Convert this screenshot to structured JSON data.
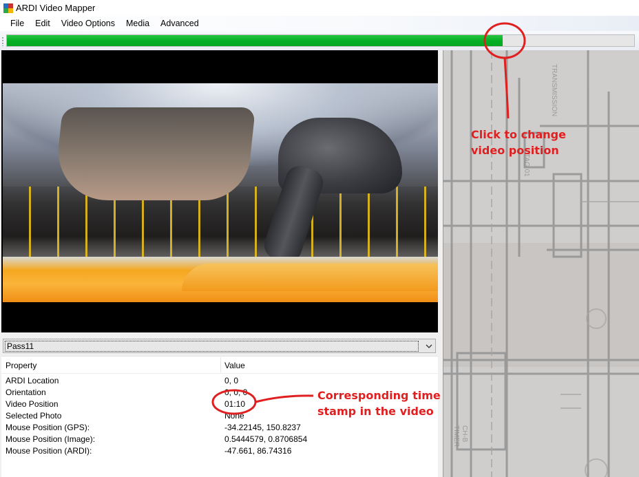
{
  "window": {
    "title": "ARDI Video Mapper"
  },
  "menu": {
    "items": [
      "File",
      "Edit",
      "Video Options",
      "Media",
      "Advanced"
    ]
  },
  "seekbar": {
    "progress": 0.79,
    "fill_color": "#06b025"
  },
  "pass_select": {
    "selected": "Pass11"
  },
  "properties": {
    "header_property": "Property",
    "header_value": "Value",
    "rows": [
      {
        "name": "ARDI Location",
        "value": "0, 0"
      },
      {
        "name": "Orientation",
        "value": "0, 0, 0"
      },
      {
        "name": "Video Position",
        "value": "01:10"
      },
      {
        "name": "Selected Photo",
        "value": "None"
      },
      {
        "name": "Mouse Position (GPS):",
        "value": "-34.22145, 150.8237"
      },
      {
        "name": "Mouse Position (Image):",
        "value": "0.5444579, 0.8706854"
      },
      {
        "name": "Mouse Position (ARDI):",
        "value": "-47.661, 86.74316"
      }
    ]
  },
  "annotations": {
    "seek_note": "Click to change video position",
    "timestamp_note": "Corresponding time stamp in the video",
    "color": "#e02020"
  },
  "map": {
    "labels": [
      "TRANSMISSION",
      "TAG 01",
      "CH-B",
      "TIMER"
    ]
  }
}
